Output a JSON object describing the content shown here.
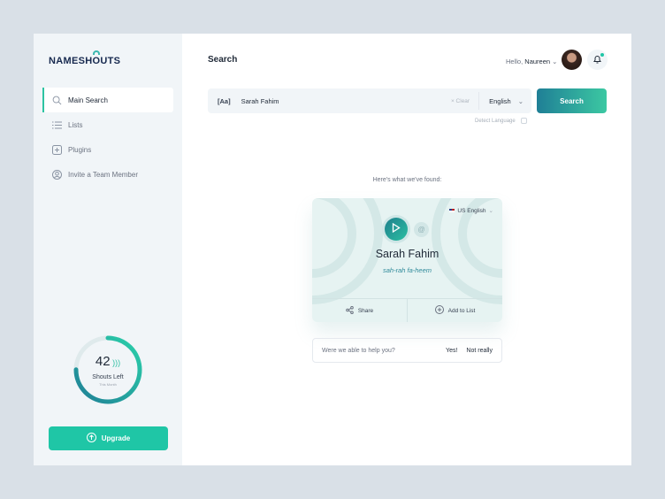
{
  "brand": {
    "logo": "NAMESHOUTS"
  },
  "sidebar": {
    "items": [
      {
        "label": "Main Search",
        "icon": "search-icon",
        "active": true
      },
      {
        "label": "Lists",
        "icon": "list-icon"
      },
      {
        "label": "Plugins",
        "icon": "plus-square-icon"
      },
      {
        "label": "Invite a Team Member",
        "icon": "user-circle-icon"
      }
    ],
    "usage": {
      "count": "42",
      "label": "Shouts Left",
      "sublabel": "This Month",
      "progress": 0.75
    },
    "upgrade_label": "Upgrade"
  },
  "header": {
    "title": "Search",
    "greeting": "Hello,",
    "user": "Naureen"
  },
  "search": {
    "prefix": "[Aa]",
    "value": "Sarah Fahim",
    "clear": "× Clear",
    "language": "English",
    "button": "Search",
    "detect": "Detect Language"
  },
  "result": {
    "heading": "Here's what we've found:",
    "accent": "US English",
    "name": "Sarah Fahim",
    "phonetic": "sah-rah fa-heem",
    "share": "Share",
    "add": "Add to List"
  },
  "feedback": {
    "question": "Were we able to help you?",
    "yes": "Yes!",
    "no": "Not really"
  },
  "colors": {
    "accent": "#1fc6a6",
    "primary_dark": "#1f7f96"
  }
}
